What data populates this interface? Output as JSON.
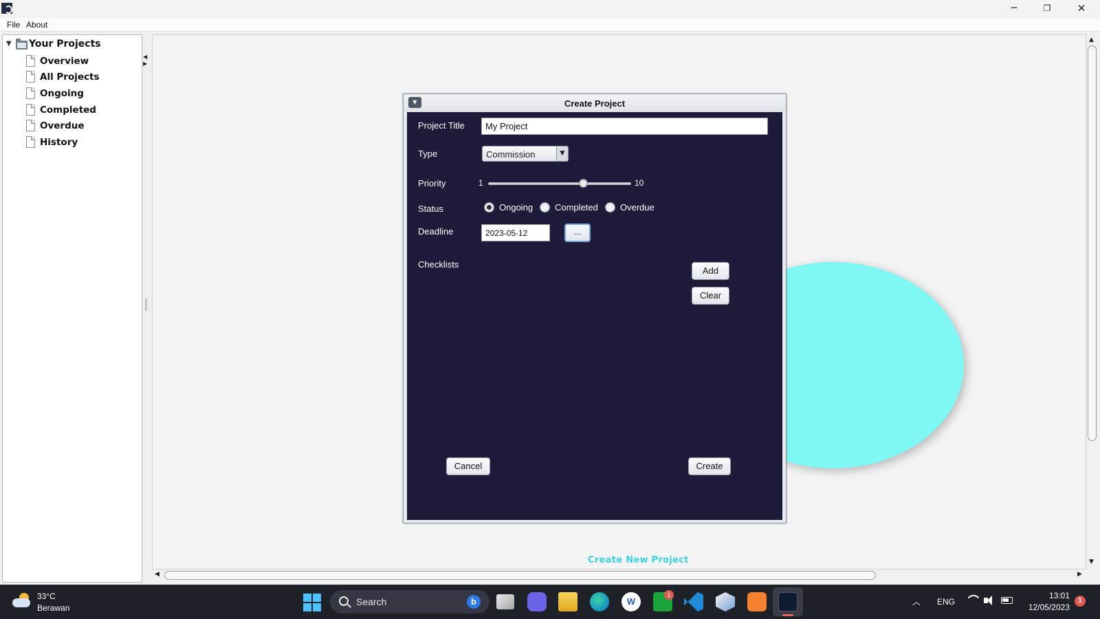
{
  "window": {
    "minimize_icon": "minimize-icon",
    "maximize_icon": "restore-icon",
    "close_icon": "close-icon",
    "minimize_glyph": "─",
    "maximize_glyph": "❐",
    "close_glyph": "✕"
  },
  "menu": {
    "file": "File",
    "about": "About"
  },
  "sidebar": {
    "root_label": "Your Projects",
    "toggle_glyph": "▼",
    "items": [
      {
        "label": "Overview"
      },
      {
        "label": "All Projects"
      },
      {
        "label": "Ongoing"
      },
      {
        "label": "Completed"
      },
      {
        "label": "Overdue"
      },
      {
        "label": "History"
      }
    ]
  },
  "splitter": {
    "arrows": "◀\n▶"
  },
  "main": {
    "create_new_link": "Create New Project",
    "accent_color": "#3ad3e6",
    "circle_color": "#7ff7f4"
  },
  "scroll": {
    "up": "▲",
    "down": "▼",
    "left": "◀",
    "right": "▶"
  },
  "dialog": {
    "title": "Create Project",
    "menu_glyph": "▼",
    "background_color": "#1d1a3a",
    "labels": {
      "project_title": "Project Title",
      "type": "Type",
      "priority": "Priority",
      "status": "Status",
      "deadline": "Deadline",
      "checklists": "Checklists"
    },
    "project_title_value": "My Project",
    "type_value": "Commission",
    "type_arrow": "▼",
    "priority": {
      "min_label": "1",
      "max_label": "10",
      "min": 1,
      "max": 10,
      "value": 7
    },
    "status_options": [
      {
        "label": "Ongoing",
        "selected": true
      },
      {
        "label": "Completed",
        "selected": false
      },
      {
        "label": "Overdue",
        "selected": false
      }
    ],
    "deadline_value": "2023-05-12",
    "date_picker_label": "...",
    "add_label": "Add",
    "clear_label": "Clear",
    "cancel_label": "Cancel",
    "create_label": "Create"
  },
  "taskbar": {
    "weather_temp": "33°C",
    "weather_desc": "Berawan",
    "search_label": "Search",
    "bing_label": "b",
    "xbox_badge": "1",
    "tray_chevron": "︿",
    "language": "ENG",
    "time": "13:01",
    "date": "12/05/2023",
    "notification_badge": "1"
  }
}
